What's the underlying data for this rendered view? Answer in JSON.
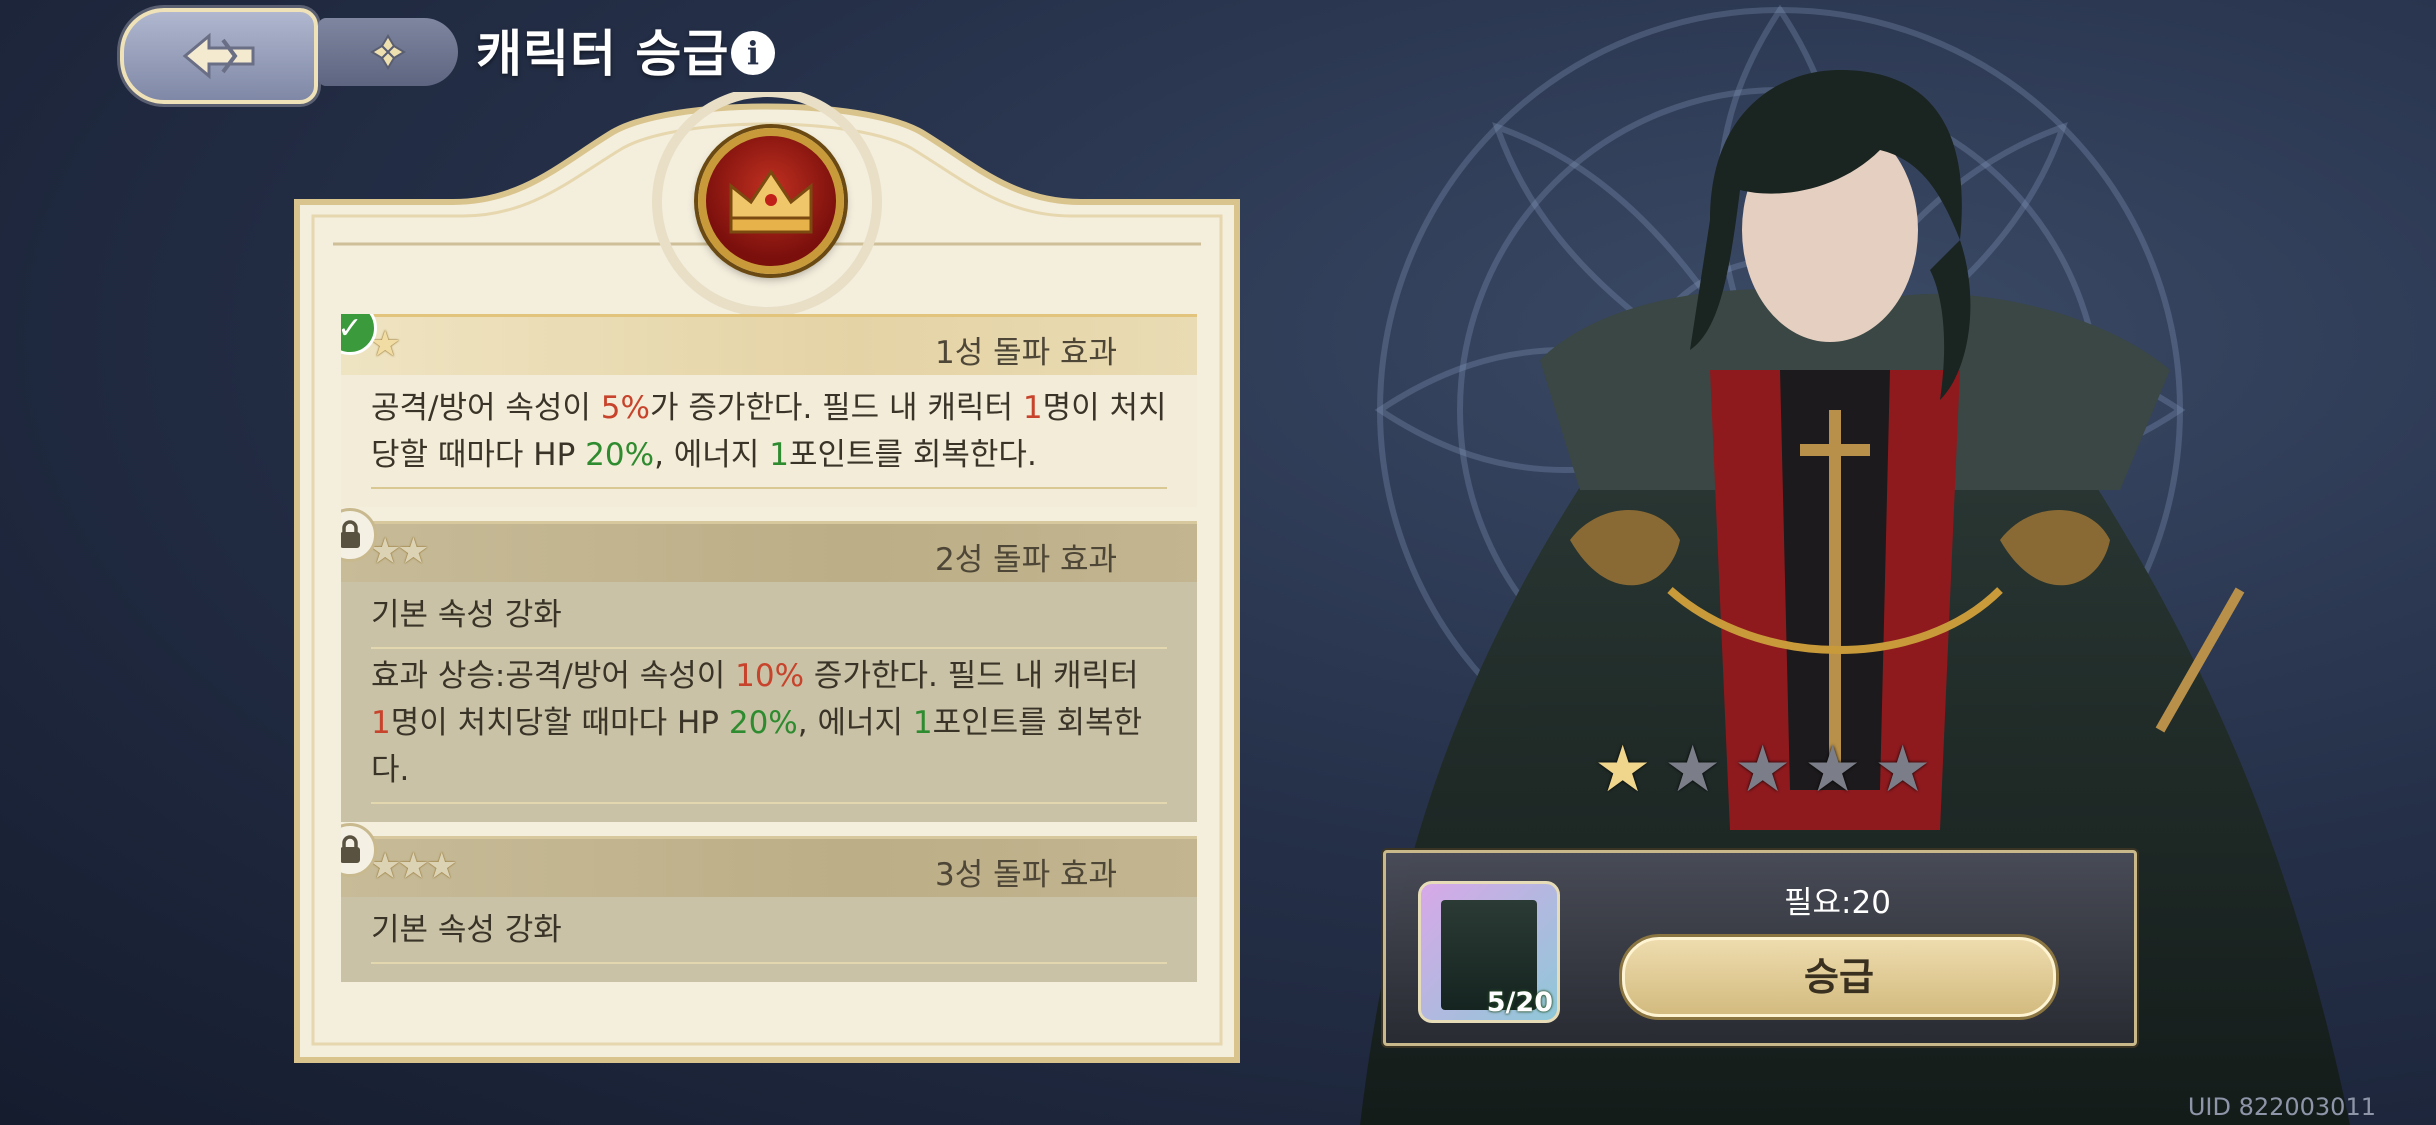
{
  "header": {
    "title": "캐릭터 승급",
    "info_glyph": "i"
  },
  "effects": [
    {
      "stars": 1,
      "title": "1성 돌파 효과",
      "status": "unlocked",
      "status_icon": "check-icon",
      "sections": [
        [
          {
            "t": "공격/방어 속성이 "
          },
          {
            "t": "5%",
            "c": "red"
          },
          {
            "t": "가 증가한다. 필드 내 캐릭터 "
          },
          {
            "t": "1",
            "c": "red"
          },
          {
            "t": "명이 처치당할 때마다 HP "
          },
          {
            "t": "20%",
            "c": "green"
          },
          {
            "t": ", 에너지 "
          },
          {
            "t": "1",
            "c": "green"
          },
          {
            "t": "포인트를 회복한다."
          }
        ]
      ]
    },
    {
      "stars": 2,
      "title": "2성 돌파 효과",
      "status": "locked",
      "status_icon": "lock-icon",
      "sections": [
        [
          {
            "t": "기본 속성 강화"
          }
        ],
        [
          {
            "t": "효과 상승:공격/방어 속성이 "
          },
          {
            "t": "10%",
            "c": "red"
          },
          {
            "t": " 증가한다. 필드 내 캐릭터 "
          },
          {
            "t": "1",
            "c": "red"
          },
          {
            "t": "명이 처치당할 때마다 HP "
          },
          {
            "t": "20%",
            "c": "green"
          },
          {
            "t": ", 에너지 "
          },
          {
            "t": "1",
            "c": "green"
          },
          {
            "t": "포인트를 회복한다."
          }
        ]
      ]
    },
    {
      "stars": 3,
      "title": "3성 돌파 효과",
      "status": "locked",
      "status_icon": "lock-icon",
      "sections": [
        [
          {
            "t": "기본 속성 강화"
          }
        ]
      ]
    }
  ],
  "colors": {
    "highlight_red": "#c8432b",
    "highlight_green": "#2f8b2f",
    "gold": "#d3bb7f",
    "unlocked_check": "#3b9a3c"
  },
  "character": {
    "star_rating": 1,
    "max_stars": 5
  },
  "promotion": {
    "item_count": "5/20",
    "required_text": "필요:20",
    "button_label": "승급"
  },
  "uid": "UID 822003011"
}
